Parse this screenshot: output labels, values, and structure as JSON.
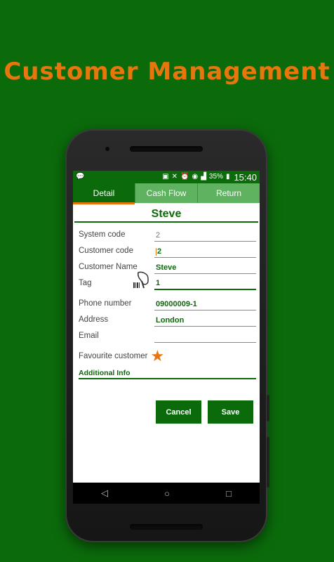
{
  "promo": {
    "title": "Customer Management"
  },
  "status_bar": {
    "battery": "35%",
    "time": "15:40"
  },
  "tabs": [
    {
      "label": "Detail",
      "active": true
    },
    {
      "label": "Cash Flow",
      "active": false
    },
    {
      "label": "Return",
      "active": false
    }
  ],
  "customer": {
    "name": "Steve"
  },
  "form": {
    "system_code": {
      "label": "System code",
      "value": "2"
    },
    "customer_code": {
      "label": "Customer code",
      "value": "2"
    },
    "customer_name": {
      "label": "Customer Name",
      "value": "Steve"
    },
    "tag": {
      "label": "Tag",
      "value": "1"
    },
    "phone": {
      "label": "Phone number",
      "value": "09000009-1"
    },
    "address": {
      "label": "Address",
      "value": "London"
    },
    "email": {
      "label": "Email",
      "value": ""
    },
    "favourite": {
      "label": "Favourite customer",
      "starred": true
    }
  },
  "additional_info": {
    "label": "Additional Info"
  },
  "buttons": {
    "cancel": "Cancel",
    "save": "Save"
  },
  "colors": {
    "brand_green": "#0b6b0b",
    "tab_green": "#5fb25f",
    "accent_orange": "#e8760c"
  }
}
